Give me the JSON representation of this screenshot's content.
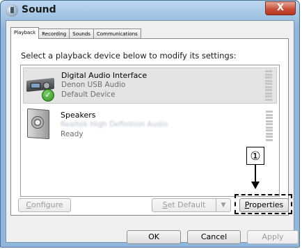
{
  "window": {
    "title": "Sound",
    "close_glyph": "X"
  },
  "tabs": [
    {
      "label": "Playback",
      "active": true
    },
    {
      "label": "Recording",
      "active": false
    },
    {
      "label": "Sounds",
      "active": false
    },
    {
      "label": "Communications",
      "active": false
    }
  ],
  "prompt": "Select a playback device below to modify its settings:",
  "devices": [
    {
      "name": "Digital Audio Interface",
      "line2": "Denon USB Audio",
      "status": "Default Device",
      "icon": "audio-interface-icon",
      "badge": "check-icon",
      "badge_glyph": "✓",
      "selected": true
    },
    {
      "name": "Speakers",
      "line2": "Realtek High Definition Audio",
      "status": "Ready",
      "icon": "speaker-icon",
      "selected": false
    }
  ],
  "annotation": {
    "number": "①"
  },
  "buttons": {
    "configure": {
      "first": "C",
      "rest": "onfigure"
    },
    "set_default": {
      "first": "S",
      "rest": "et Default"
    },
    "dropdown_glyph": "▼",
    "properties": {
      "first": "P",
      "rest": "roperties"
    },
    "ok": "OK",
    "cancel": "Cancel",
    "apply": "Apply"
  }
}
